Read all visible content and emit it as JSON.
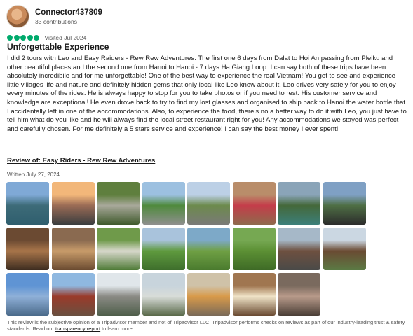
{
  "reviewer": {
    "name": "Connector437809",
    "contributions": "33 contributions"
  },
  "rating": {
    "bubbles": 5,
    "max": 5,
    "visited": "Visited Jul 2024"
  },
  "review": {
    "title": "Unforgettable Experience",
    "text": "I did 2 tours with Leo and Easy Raiders - Rew Rew Adventures: The first one 6 days from Dalat to Hoi An passing from Pleiku and other beautiful places and the second one from Hanoi to Hanoi - 7 days Ha Giang Loop. I can say both of these trips have been absolutely incredibile and for me unforgettable! One of the best way to experience the real Vietnam! You get to see and experience little villages life and nature and definitely hidden gems that only local like Leo know about it. Leo drives very safely for you to enjoy every minutes of the rides. He is always happy to stop for you to take photos or if you need to rest. His customer service and knowledge are exceptional! He even drove back to try to find my lost glasses and organised to ship back to Hanoi the water bottle that I accidentally left in one of the accommodations. Also, to experience the food, there's no a better way to do it with Leo, you just have to tell him what do you like and he will always find the local street restaurant right for you! Any accommodations we stayed was perfect and carefully chosen. For me definitely a 5 stars service and experience! I can say the best money I ever spent!",
    "review_of": "Review of: Easy Riders - Rew Rew Adventures",
    "written": "Written July 27, 2024"
  },
  "photos": [
    {
      "scene": "lake-mountains",
      "top": "#7fa9d6",
      "mid": "#3d6b78",
      "bottom": "#2f5e6e"
    },
    {
      "scene": "sunset-valley",
      "top": "#f2b77a",
      "mid": "#9a6b55",
      "bottom": "#3a3d3f"
    },
    {
      "scene": "waterfall-forest",
      "top": "#5f7f3e",
      "mid": "#a8a89a",
      "bottom": "#3f5a2c"
    },
    {
      "scene": "mountain-road",
      "top": "#9cc0e0",
      "mid": "#4f8a3c",
      "bottom": "#8f8f8f"
    },
    {
      "scene": "road-hills",
      "top": "#bcd0e6",
      "mid": "#6c8a4c",
      "bottom": "#7a7a78"
    },
    {
      "scene": "local-villagers",
      "top": "#b98d6a",
      "mid": "#c43d4a",
      "bottom": "#8e6a4c"
    },
    {
      "scene": "river-canyon",
      "top": "#8aa4b8",
      "mid": "#44683a",
      "bottom": "#3c7f7a"
    },
    {
      "scene": "riders-selfie",
      "top": "#7fa0c4",
      "mid": "#4e6e44",
      "bottom": "#2c2c2c"
    },
    {
      "scene": "market-crafts",
      "top": "#6b4a32",
      "mid": "#a8754a",
      "bottom": "#3d2c20"
    },
    {
      "scene": "street-food",
      "top": "#8a6a50",
      "mid": "#c89c6a",
      "bottom": "#6a4a30"
    },
    {
      "scene": "serpentine-road",
      "top": "#6f9a4a",
      "mid": "#d8d8cc",
      "bottom": "#4e7a36"
    },
    {
      "scene": "rice-valley",
      "top": "#a9c3dc",
      "mid": "#5f9a3e",
      "bottom": "#3e6e2c"
    },
    {
      "scene": "terraced-fields",
      "top": "#7da9c8",
      "mid": "#6fa044",
      "bottom": "#4a7a2e"
    },
    {
      "scene": "green-terraces",
      "top": "#76a852",
      "mid": "#5c9034",
      "bottom": "#3e6a26"
    },
    {
      "scene": "suspension-bridge",
      "top": "#a6b8c8",
      "mid": "#6e5040",
      "bottom": "#4a4a48"
    },
    {
      "scene": "stilt-house",
      "top": "#cbd7e2",
      "mid": "#6a4a32",
      "bottom": "#5b7a44"
    },
    {
      "scene": "lakeside-tower",
      "top": "#5f94d4",
      "mid": "#8fb0d8",
      "bottom": "#4a6a8a"
    },
    {
      "scene": "temple-gate",
      "top": "#8fb8e0",
      "mid": "#9a3a2a",
      "bottom": "#6a5040"
    },
    {
      "scene": "waterfall-rocks",
      "top": "#e0e6ea",
      "mid": "#8a8a84",
      "bottom": "#4e5e4a"
    },
    {
      "scene": "dam-spillway",
      "top": "#c8d4dc",
      "mid": "#d8dcd8",
      "bottom": "#5a6a4a"
    },
    {
      "scene": "coconut-drink",
      "top": "#cfc2a8",
      "mid": "#d89a4a",
      "bottom": "#7a6a58"
    },
    {
      "scene": "noodle-dish",
      "top": "#a07650",
      "mid": "#f0e4c8",
      "bottom": "#6a4a32"
    },
    {
      "scene": "market-table",
      "top": "#7a6a5e",
      "mid": "#b89a8a",
      "bottom": "#4a3e36"
    }
  ],
  "disclaimer": {
    "text_before": "This review is the subjective opinion of a Tripadvisor member and not of Tripadvisor LLC. Tripadvisor performs checks on reviews as part of our industry-leading trust & safety standards. Read our ",
    "link": "transparency report",
    "text_after": " to learn more."
  },
  "colors": {
    "rating_green": "#00aa6c",
    "text": "#1a1a1a",
    "muted": "#555555"
  }
}
